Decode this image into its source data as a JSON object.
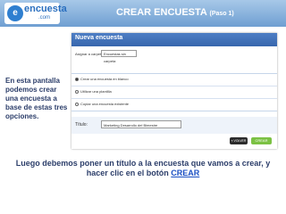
{
  "header": {
    "logo_mark": "e",
    "logo_text": "encuesta",
    "logo_sub": ".com",
    "title": "CREAR ENCUESTA",
    "step": "(Paso 1)"
  },
  "app": {
    "title": "Nueva encuesta",
    "select_label": "Asignar a carpeta:",
    "select_value": "Encuestas sin carpeta",
    "options": [
      {
        "label": "Crear una encuesta en blanco",
        "selected": true
      },
      {
        "label": "Utilizar una plantilla",
        "selected": false
      },
      {
        "label": "Copiar una encuesta existente",
        "selected": false
      }
    ],
    "titulo_label": "Título:",
    "titulo_value": "Marketing Desarrollo del Bimestre",
    "volver_label": "« VOLVER",
    "crear_label": "CREAR"
  },
  "notes": {
    "side": "En esta pantalla podemos crear una encuesta a base de estas tres opciones.",
    "bottom_text": "Luego debemos poner un título a la encuesta que vamos a crear, y hacer clic en el botón",
    "bottom_link": "CREAR"
  },
  "colors": {
    "header_gradient_top": "#a7c8e8",
    "app_header": "#3766ad",
    "crear_button": "#7bc143",
    "volver_button": "#2b2b2b",
    "note_text": "#2c3e6a"
  }
}
